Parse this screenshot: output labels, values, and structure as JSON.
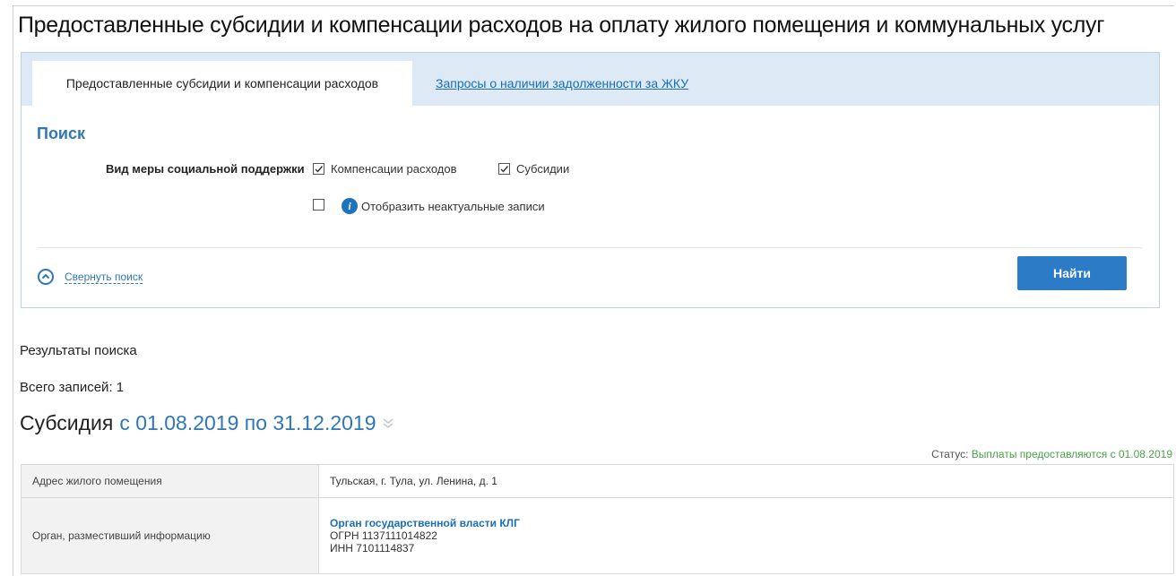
{
  "page": {
    "title": "Предоставленные субсидии и компенсации расходов на оплату жилого помещения и коммунальных услуг"
  },
  "tabs": [
    {
      "label": "Предоставленные субсидии и компенсации расходов",
      "active": true
    },
    {
      "label": "Запросы о наличии задолженности за ЖКУ",
      "active": false
    }
  ],
  "search": {
    "heading": "Поиск",
    "support_type_label": "Вид меры социальной поддержки",
    "options": [
      {
        "label": "Компенсации расходов",
        "checked": true
      },
      {
        "label": "Субсидии",
        "checked": true
      }
    ],
    "show_inactive": {
      "label": "Отобразить неактуальные записи",
      "checked": false
    },
    "collapse_label": "Свернуть поиск",
    "find_button": "Найти"
  },
  "results": {
    "title": "Результаты поиска",
    "total": "Всего записей: 1",
    "record": {
      "type": "Субсидия",
      "period": "с 01.08.2019 по 31.12.2019",
      "status_label": "Статус:",
      "status_value": "Выплаты предоставляются с 01.08.2019",
      "rows": [
        {
          "key": "Адрес жилого помещения",
          "value": "Тульская, г. Тула, ул. Ленина, д. 1"
        },
        {
          "key": "Орган, разместивший информацию",
          "org_name": "Орган государственной власти КЛГ",
          "ogrn": "ОГРН 1137111014822",
          "inn": "ИНН 7101114837"
        }
      ]
    }
  },
  "colors": {
    "accent": "#2f77b5",
    "button": "#2b7bc7",
    "status_green": "#4aa24a",
    "tabbar_bg": "#dde9f4"
  }
}
